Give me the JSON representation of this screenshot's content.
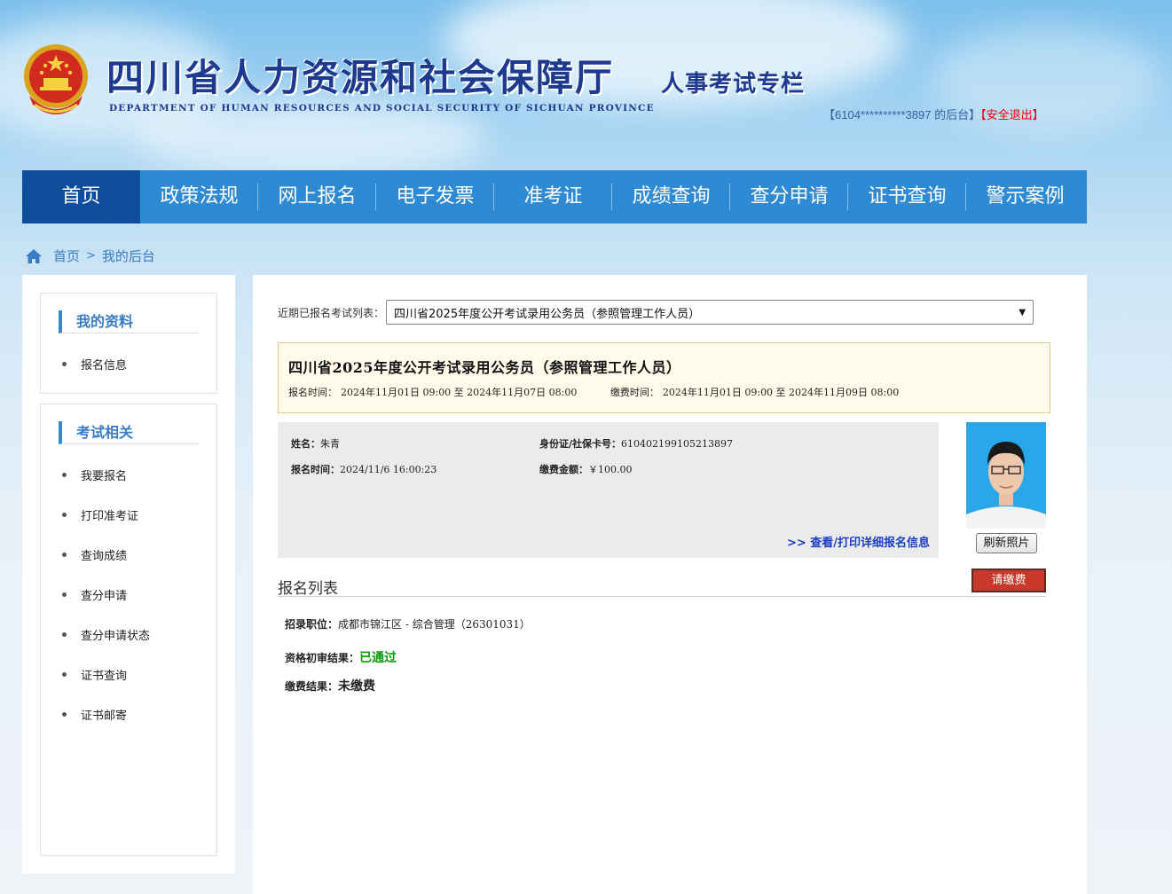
{
  "header": {
    "site_title": "四川省人力资源和社会保障厅",
    "site_subtitle": "DEPARTMENT OF HUMAN RESOURCES AND SOCIAL SECURITY OF SICHUAN PROVINCE",
    "column_title": "人事考试专栏",
    "user_prefix": "【",
    "user_id": "6104**********3897",
    "user_suffix": " 的后台】",
    "logout": "【安全退出】"
  },
  "nav": [
    "首页",
    "政策法规",
    "网上报名",
    "电子发票",
    "准考证",
    "成绩查询",
    "查分申请",
    "证书查询",
    "警示案例"
  ],
  "breadcrumb": {
    "home": "首页",
    "sep": ">",
    "current": "我的后台"
  },
  "sidebar": {
    "profile_title": "我的资料",
    "profile_items": [
      "报名信息"
    ],
    "exam_title": "考试相关",
    "exam_items": [
      "我要报名",
      "打印准考证",
      "查询成绩",
      "查分申请",
      "查分申请状态",
      "证书查询",
      "证书邮寄"
    ]
  },
  "main": {
    "select_label": "近期已报名考试列表：",
    "select_value": "四川省2025年度公开考试录用公务员（参照管理工作人员）",
    "exam_title": "四川省2025年度公开考试录用公务员（参照管理工作人员）",
    "reg_time_label": "报名时间：",
    "reg_time": "2024年11月01日 09:00 至 2024年11月07日 08:00",
    "pay_time_label": "缴费时间：",
    "pay_time": "2024年11月01日 09:00 至 2024年11月09日 08:00",
    "name_label": "姓名：",
    "name": "朱青",
    "id_label": "身份证/社保卡号：",
    "id_number": "610402199105213897",
    "signup_time_label": "报名时间：",
    "signup_time": "2024/11/6 16:00:23",
    "fee_label": "缴费金额：",
    "fee": "￥100.00",
    "detail_link": ">> 查看/打印详细报名信息",
    "refresh_photo": "刷新照片",
    "list_title": "报名列表",
    "pay_button": "请缴费",
    "position_label": "招录职位：",
    "position": "成都市锦江区 - 综合管理（26301031）",
    "review_label": "资格初审结果：",
    "review_result": "已通过",
    "payment_label": "缴费结果：",
    "payment_result": "未缴费"
  }
}
